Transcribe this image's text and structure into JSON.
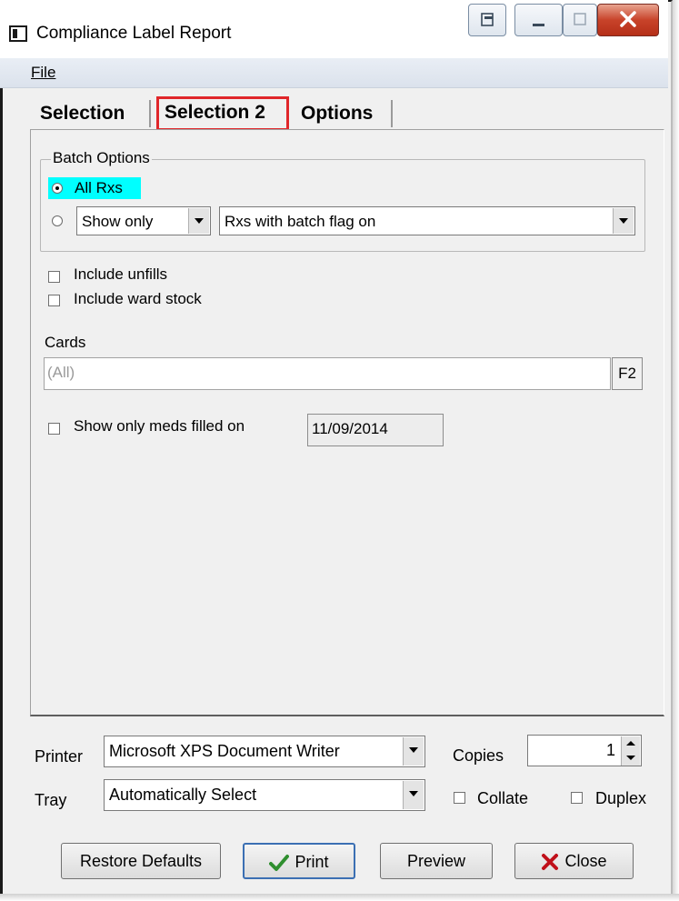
{
  "window": {
    "title": "Compliance Label Report"
  },
  "menu": {
    "file": "File"
  },
  "tabs": [
    {
      "label": "Selection"
    },
    {
      "label": "Selection 2",
      "active": true
    },
    {
      "label": "Options"
    }
  ],
  "batch_options": {
    "legend": "Batch Options",
    "all_rxs": "All Rxs",
    "show_only_select": "Show only",
    "batch_flag_select": "Rxs with batch flag on",
    "selected": "All Rxs"
  },
  "checks": {
    "include_unfills": "Include unfills",
    "include_ward_stock": "Include ward stock",
    "show_only_meds_filled_on": "Show only meds filled on"
  },
  "cards": {
    "label": "Cards",
    "value": "(All)",
    "lookup_key": "F2"
  },
  "filled_on_date": "11/09/2014",
  "printer": {
    "label": "Printer",
    "value": "Microsoft XPS Document Writer"
  },
  "tray": {
    "label": "Tray",
    "value": "Automatically Select"
  },
  "copies": {
    "label": "Copies",
    "value": "1"
  },
  "collate": "Collate",
  "duplex": "Duplex",
  "buttons": {
    "restore_defaults": "Restore Defaults",
    "print": "Print",
    "preview": "Preview",
    "close": "Close"
  },
  "colors": {
    "highlight": "#00ffff",
    "tab_outline": "#e0262a",
    "close_icon": "#c0101a",
    "check_icon": "#2f8f2f"
  },
  "icons": [
    "app-icon",
    "restore-icon",
    "minimize-icon",
    "maximize-icon",
    "close-icon",
    "print-check-icon",
    "close-x-icon"
  ]
}
